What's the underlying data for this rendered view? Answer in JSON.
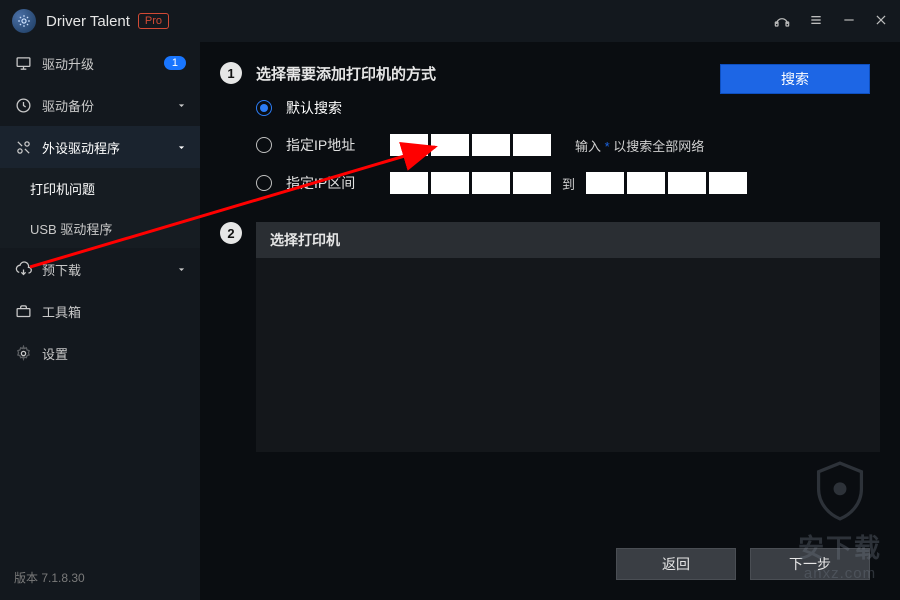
{
  "titlebar": {
    "app_name": "Driver Talent",
    "pro_badge": "Pro"
  },
  "sidebar": {
    "items": [
      {
        "label": "驱动升级",
        "badge": "1"
      },
      {
        "label": "驱动备份"
      },
      {
        "label": "外设驱动程序"
      },
      {
        "label": "预下载"
      },
      {
        "label": "工具箱"
      },
      {
        "label": "设置"
      }
    ],
    "sub_items": [
      {
        "label": "打印机问题"
      },
      {
        "label": "USB 驱动程序"
      }
    ],
    "version": "版本 7.1.8.30"
  },
  "content": {
    "search_btn": "搜索",
    "step1_num": "1",
    "step1_title": "选择需要添加打印机的方式",
    "options": [
      {
        "label": "默认搜索"
      },
      {
        "label": "指定IP地址"
      },
      {
        "label": "指定IP区间"
      }
    ],
    "ip_hint_prefix": "输入 ",
    "ip_hint_star": "*",
    "ip_hint_suffix": " 以搜索全部网络",
    "range_sep": "到",
    "step2_num": "2",
    "step2_title": "选择打印机",
    "btn_back": "返回",
    "btn_next": "下一步"
  },
  "watermark": {
    "cn": "安下载",
    "en": "anxz.com"
  }
}
